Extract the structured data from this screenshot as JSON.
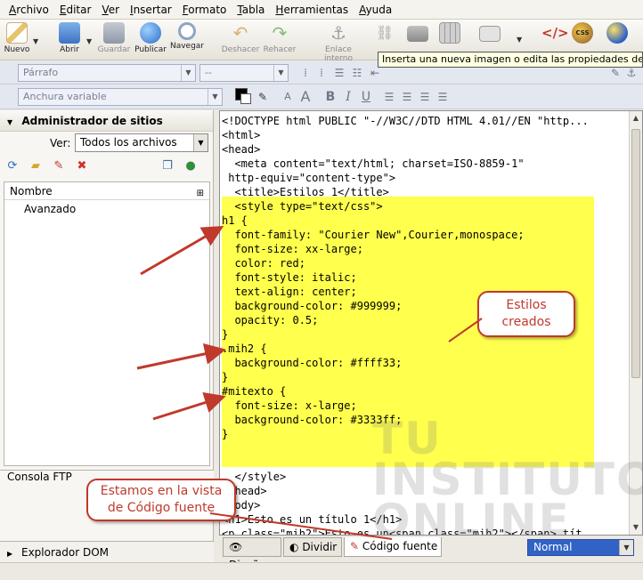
{
  "menu": [
    "Archivo",
    "Editar",
    "Ver",
    "Insertar",
    "Formato",
    "Tabla",
    "Herramientas",
    "Ayuda"
  ],
  "toolbar": {
    "buttons": [
      {
        "label": "Nuevo",
        "icon": "pencil-icon",
        "color": "#e8c36a"
      },
      {
        "label": "Abrir",
        "icon": "open-folder-icon",
        "color": "#5b8fd8"
      },
      {
        "label": "Guardar",
        "icon": "save-disk-icon",
        "color": "#9aa3b3"
      },
      {
        "label": "Publicar",
        "icon": "globe-publish-icon",
        "color": "#3f86d8"
      },
      {
        "label": "Navegar",
        "icon": "browse-magnifier-icon",
        "color": "#8fa5c4"
      },
      {
        "label": "Deshacer",
        "icon": "undo-icon",
        "color": "#d9b070"
      },
      {
        "label": "Rehacer",
        "icon": "redo-icon",
        "color": "#8ab87a"
      },
      {
        "label": "Enlace interno",
        "icon": "anchor-icon",
        "color": "#a0a0a0"
      }
    ],
    "tooltip": "Inserta una nueva imagen o edita las propiedades de la"
  },
  "format": {
    "paragraph": "Párrafo",
    "font": "--",
    "width": "Anchura variable"
  },
  "sidebar": {
    "title": "Administrador de sitios",
    "view_label": "Ver:",
    "view_value": "Todos los archivos",
    "tree_header": "Nombre",
    "tree_items": [
      "Avanzado"
    ],
    "ftp": "Consola FTP",
    "dom": "Explorador DOM"
  },
  "code_lines": [
    "<!DOCTYPE html PUBLIC \"-//W3C//DTD HTML 4.01//EN \"http...",
    "<html>",
    "<head>",
    "  <meta content=\"text/html; charset=ISO-8859-1\"",
    " http-equiv=\"content-type\">",
    "  <title>Estilos 1</title>",
    "  <style type=\"text/css\">",
    "h1 {",
    "  font-family: \"Courier New\",Courier,monospace;",
    "  font-size: xx-large;",
    "  color: red;",
    "  font-style: italic;",
    "  text-align: center;",
    "  background-color: #999999;",
    "  opacity: 0.5;",
    "}",
    ".mih2 {",
    "  background-color: #ffff33;",
    "}",
    "#mitexto {",
    "  font-size: x-large;",
    "  background-color: #3333ff;",
    "}",
    "",
    "",
    "  </style>",
    "</head>",
    "<body>",
    "<h1>Esto es un título 1</h1>",
    "<p class=\"mih2\">Esto es un<span class=\"mih2\"></span> tít"
  ],
  "tabs": {
    "design": "Diseño",
    "split": "Dividir",
    "source": "Código fuente"
  },
  "mode": "Normal",
  "callouts": {
    "styles": "Estilos creados",
    "view": "Estamos en la vista de Código fuente"
  },
  "watermark": "TU INSTITUTO ONLINE",
  "colors": {
    "highlight": "#ffff4d",
    "callout_red": "#c0392b",
    "mode_select": "#3162c6"
  }
}
